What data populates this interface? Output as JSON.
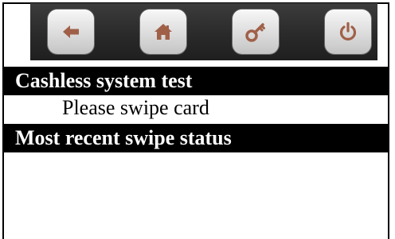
{
  "toolbar": {
    "buttons": [
      {
        "icon": "back-arrow-icon"
      },
      {
        "icon": "home-icon"
      },
      {
        "icon": "key-icon"
      },
      {
        "icon": "power-icon"
      }
    ],
    "icon_color": "#a06048"
  },
  "test_section": {
    "title": "Cashless system test",
    "prompt": "Please swipe card"
  },
  "status_section": {
    "title": "Most recent swipe status"
  }
}
